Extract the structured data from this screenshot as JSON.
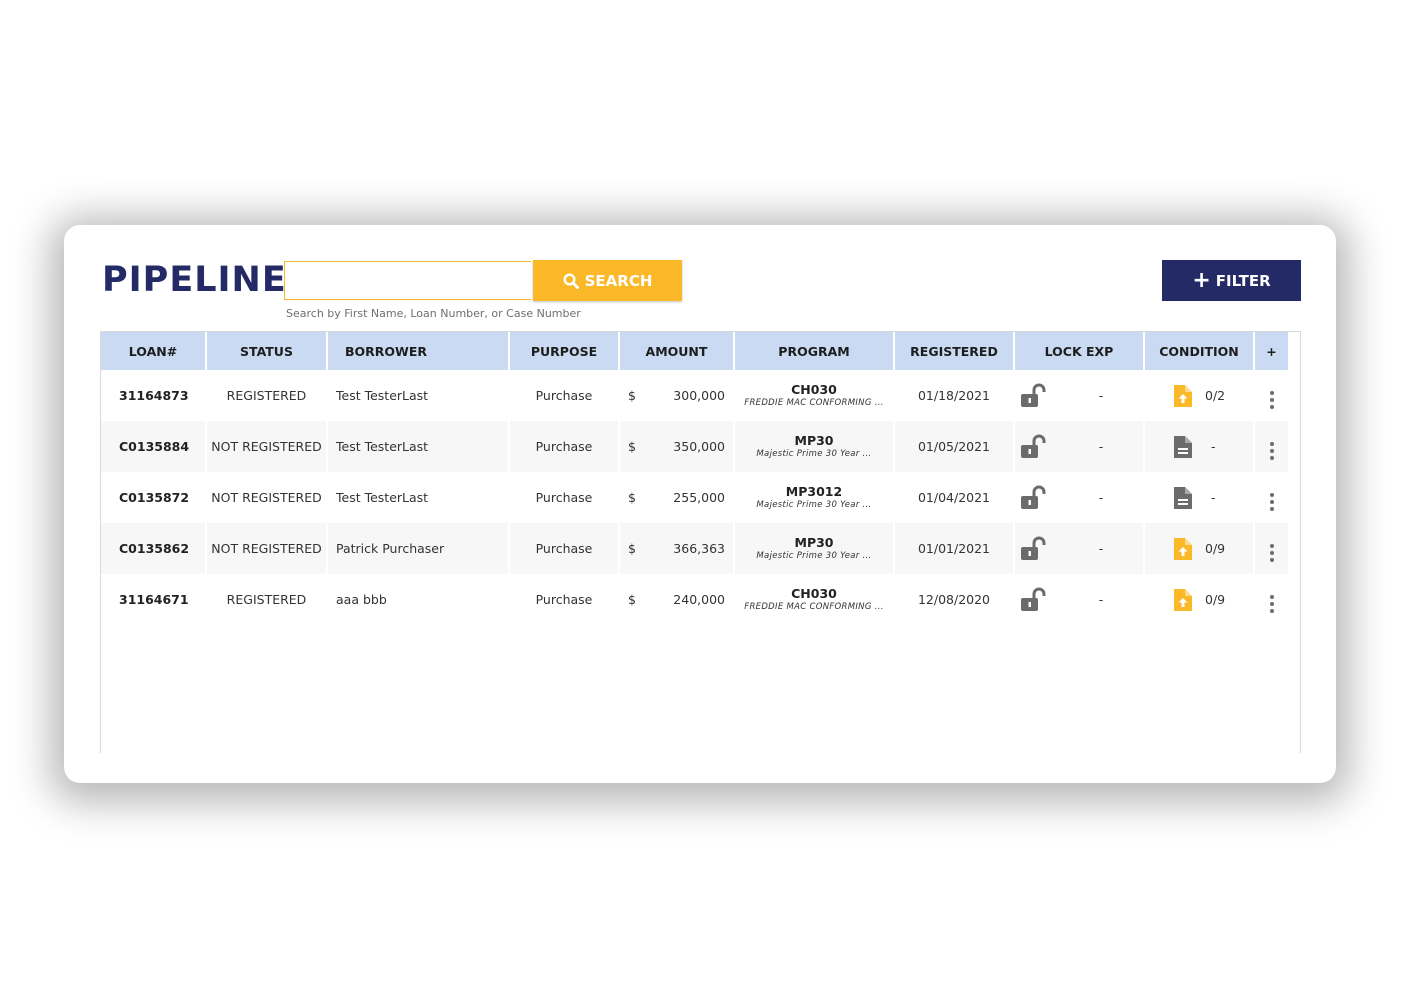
{
  "header": {
    "title": "PIPELINE",
    "search": {
      "value": "",
      "placeholder": "",
      "button_label": "SEARCH",
      "hint": "Search by First Name, Loan Number, or Case Number"
    },
    "filter_label": "FILTER"
  },
  "table": {
    "columns": [
      "LOAN#",
      "STATUS",
      "BORROWER",
      "PURPOSE",
      "AMOUNT",
      "PROGRAM",
      "REGISTERED",
      "LOCK EXP",
      "CONDITION",
      "+"
    ],
    "rows": [
      {
        "loan": "31164873",
        "status": "REGISTERED",
        "borrower": "Test TesterLast",
        "purpose": "Purchase",
        "currency": "$",
        "amount": "300,000",
        "program_code": "CH030",
        "program_name": "FREDDIE MAC CONFORMING ...",
        "registered": "01/18/2021",
        "lock_exp": "-",
        "condition_icon": "file-upload-icon",
        "condition": "0/2"
      },
      {
        "loan": "C0135884",
        "status": "NOT REGISTERED",
        "borrower": "Test TesterLast",
        "purpose": "Purchase",
        "currency": "$",
        "amount": "350,000",
        "program_code": "MP30",
        "program_name": "Majestic Prime 30 Year ...",
        "registered": "01/05/2021",
        "lock_exp": "-",
        "condition_icon": "file-icon",
        "condition": "-"
      },
      {
        "loan": "C0135872",
        "status": "NOT REGISTERED",
        "borrower": "Test TesterLast",
        "purpose": "Purchase",
        "currency": "$",
        "amount": "255,000",
        "program_code": "MP3012",
        "program_name": "Majestic Prime 30 Year ...",
        "registered": "01/04/2021",
        "lock_exp": "-",
        "condition_icon": "file-icon",
        "condition": "-"
      },
      {
        "loan": "C0135862",
        "status": "NOT REGISTERED",
        "borrower": "Patrick Purchaser",
        "purpose": "Purchase",
        "currency": "$",
        "amount": "366,363",
        "program_code": "MP30",
        "program_name": "Majestic Prime 30 Year ...",
        "registered": "01/01/2021",
        "lock_exp": "-",
        "condition_icon": "file-upload-icon",
        "condition": "0/9"
      },
      {
        "loan": "31164671",
        "status": "REGISTERED",
        "borrower": "aaa bbb",
        "purpose": "Purchase",
        "currency": "$",
        "amount": "240,000",
        "program_code": "CH030",
        "program_name": "FREDDIE MAC CONFORMING ...",
        "registered": "12/08/2020",
        "lock_exp": "-",
        "condition_icon": "file-upload-icon",
        "condition": "0/9"
      }
    ]
  },
  "colors": {
    "brand_navy": "#232a66",
    "accent_yellow": "#fbb92a",
    "header_blue": "#c9daf2",
    "lock_gray": "#6b6b6b"
  }
}
